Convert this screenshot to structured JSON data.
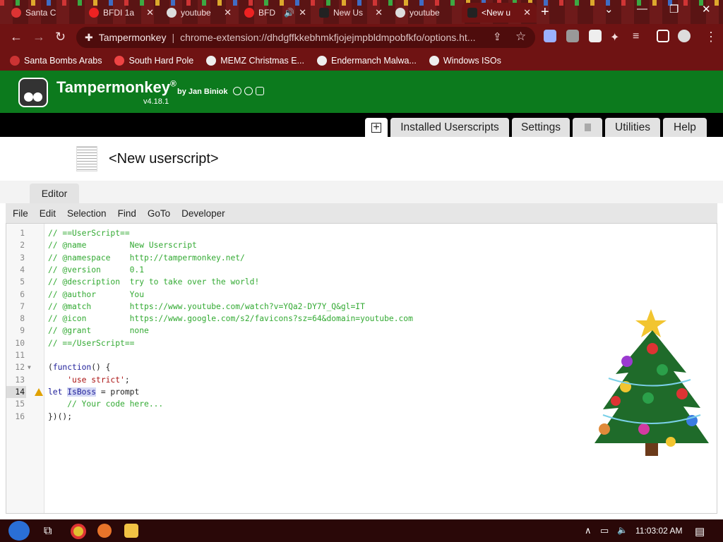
{
  "browser": {
    "tabs": [
      {
        "title": "Santa C",
        "fav_color": "#d33"
      },
      {
        "title": "BFDI 1a",
        "fav_color": "#e22"
      },
      {
        "title": "youtube",
        "fav_color": "#ddd"
      },
      {
        "title": "BFD",
        "fav_color": "#e22"
      },
      {
        "title": "New Us",
        "fav_color": "#222"
      },
      {
        "title": "youtube",
        "fav_color": "#ddd"
      },
      {
        "title": "<New u",
        "fav_color": "#222"
      }
    ],
    "address": {
      "site": "Tampermonkey",
      "url": "chrome-extension://dhdgffkkebhmkfjojejmpbldmpobfkfo/options.ht..."
    },
    "bookmarks": [
      {
        "label": "Santa Bombs Arabs"
      },
      {
        "label": "South Hard Pole"
      },
      {
        "label": "MEMZ Christmas E..."
      },
      {
        "label": "Endermanch Malwa..."
      },
      {
        "label": "Windows ISOs"
      }
    ]
  },
  "tampermonkey": {
    "title": "Tampermonkey",
    "registered": "®",
    "by": "by Jan Biniok",
    "version": "v4.18.1",
    "tabs": [
      "Installed Userscripts",
      "Settings",
      "Utilities",
      "Help"
    ],
    "script_name": "<New userscript>",
    "editor_tab": "Editor",
    "menu": [
      "File",
      "Edit",
      "Selection",
      "Find",
      "GoTo",
      "Developer"
    ]
  },
  "code_lines": [
    "// ==UserScript==",
    "// @name         New Userscript",
    "// @namespace    http://tampermonkey.net/",
    "// @version      0.1",
    "// @description  try to take over the world!",
    "// @author       You",
    "// @match        https://www.youtube.com/watch?v=YQa2-DY7Y_Q&gl=IT",
    "// @icon         https://www.google.com/s2/favicons?sz=64&domain=youtube.com",
    "// @grant        none",
    "// ==/UserScript==",
    "",
    "(function() {",
    "    'use strict';",
    "let IsBoss = prompt",
    "    // Your code here...",
    "})();"
  ],
  "current_line": 14,
  "taskbar": {
    "time": "11:03:02 AM"
  },
  "colors": {
    "tm_green": "#0c7a1d",
    "browser_frame": "#6f1313",
    "comment": "#33aa33",
    "string": "#aa1111",
    "keyword": "#20209a"
  }
}
